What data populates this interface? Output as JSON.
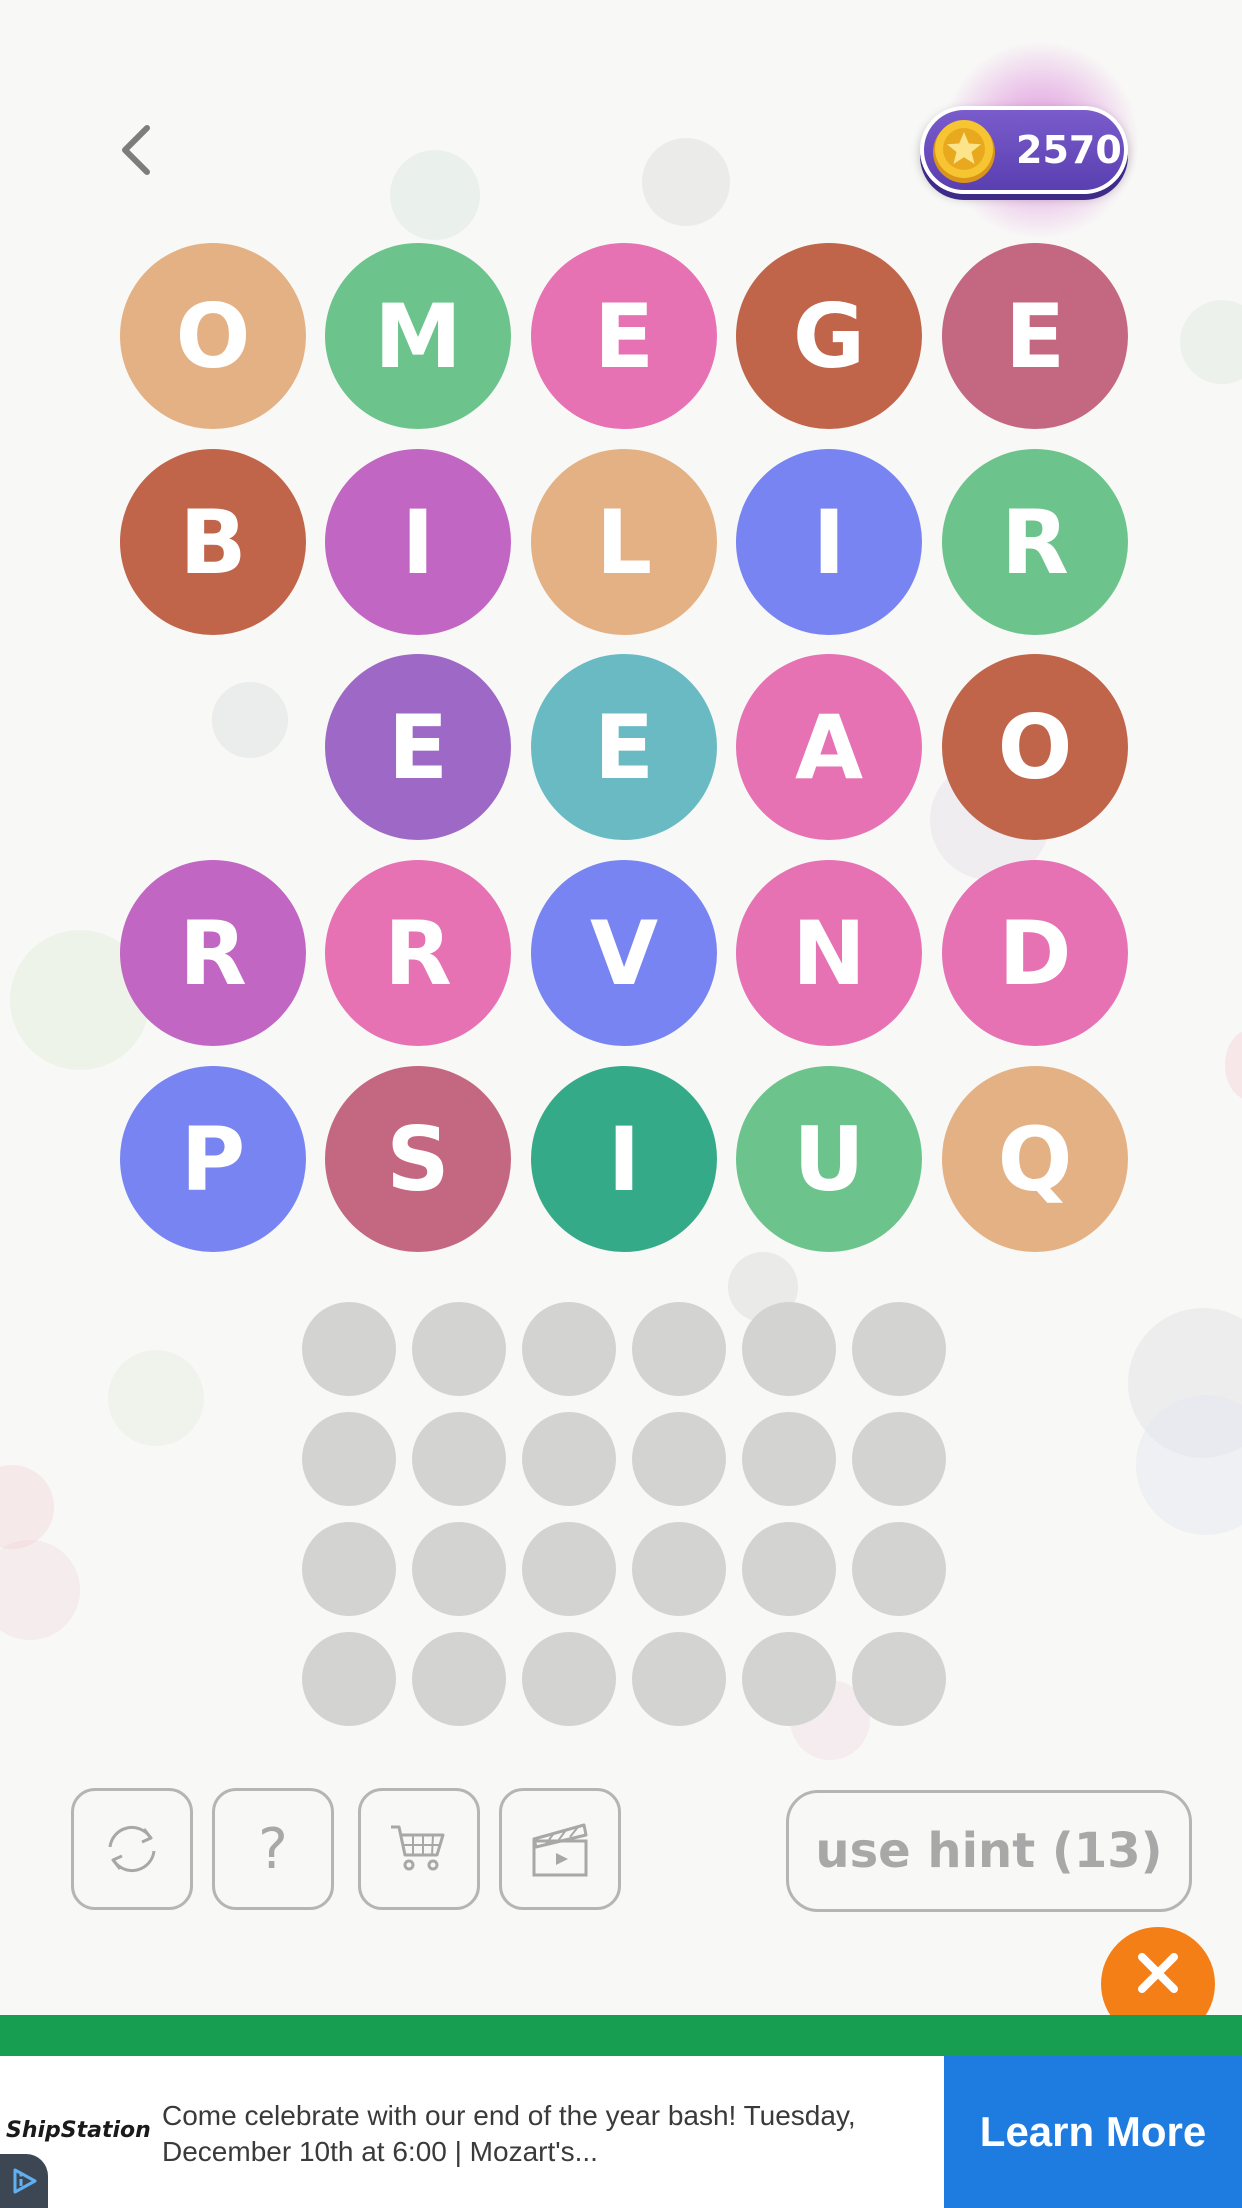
{
  "coins": {
    "count": "2570",
    "accent": "#6a4dbf"
  },
  "board": {
    "tiles": [
      {
        "letter": "O",
        "color": "#e4b184"
      },
      {
        "letter": "M",
        "color": "#6cc48c"
      },
      {
        "letter": "E",
        "color": "#e672b4"
      },
      {
        "letter": "G",
        "color": "#c0644a"
      },
      {
        "letter": "E",
        "color": "#c36880"
      },
      {
        "letter": "B",
        "color": "#c0644a"
      },
      {
        "letter": "I",
        "color": "#c166c2"
      },
      {
        "letter": "L",
        "color": "#e4b184"
      },
      {
        "letter": "I",
        "color": "#7884f2"
      },
      {
        "letter": "R",
        "color": "#6cc48c"
      },
      {
        "letter": "E",
        "color": "#9d68c6"
      },
      {
        "letter": "E",
        "color": "#6abac4"
      },
      {
        "letter": "A",
        "color": "#e672b4"
      },
      {
        "letter": "O",
        "color": "#c0644a"
      },
      {
        "letter": "R",
        "color": "#c166c2"
      },
      {
        "letter": "R",
        "color": "#e672b4"
      },
      {
        "letter": "V",
        "color": "#7884f2"
      },
      {
        "letter": "N",
        "color": "#e672b4"
      },
      {
        "letter": "D",
        "color": "#e672b4"
      },
      {
        "letter": "P",
        "color": "#7884f2"
      },
      {
        "letter": "S",
        "color": "#c36880"
      },
      {
        "letter": "I",
        "color": "#34aa88"
      },
      {
        "letter": "U",
        "color": "#6cc48c"
      },
      {
        "letter": "Q",
        "color": "#e4b184"
      }
    ],
    "answer_slots": {
      "rows": 4,
      "cols": 6,
      "color": "#d3d3d2"
    }
  },
  "toolbar": {
    "shuffle_icon": "shuffle-icon",
    "help_label": "?",
    "shop_icon": "cart-icon",
    "video_icon": "clapperboard-icon",
    "hint_label": "use hint (13)"
  },
  "ad": {
    "brand": "ShipStation",
    "text": "Come celebrate with our end of the year bash! Tuesday, December 10th at 6:00 | Mozart's...",
    "cta": "Learn More",
    "close_icon": "close-icon",
    "cta_color": "#1e7ce0",
    "strip_color": "#189e50"
  }
}
